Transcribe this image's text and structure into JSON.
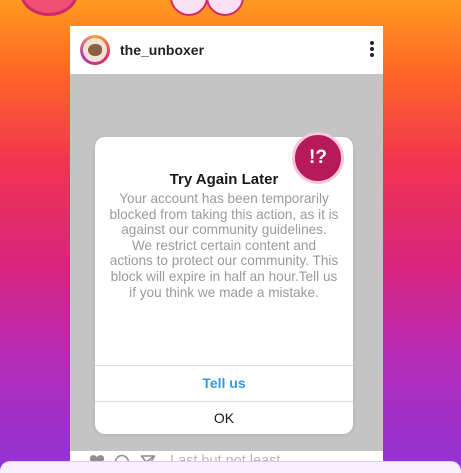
{
  "post": {
    "username": "the_unboxer",
    "caption": "Last but not least"
  },
  "alert": {
    "badge": "!?",
    "title": "Try Again Later",
    "message": "Your account has been temporarily blocked from taking this action, as it is against our community guidelines.\nWe restrict certain content and actions to protect our community. This block will expire in half an hour.Tell us if you think we made a mistake.",
    "primary_action": "Tell us",
    "secondary_action": "OK"
  },
  "icons": [
    "pink-blob-icon",
    "avatar",
    "more-options-icon",
    "heart-icon",
    "comment-icon",
    "send-icon"
  ],
  "colors": {
    "accent_blue": "#2f9be6",
    "badge_magenta": "#b61a59",
    "placeholder_gray": "#c4c4c4"
  }
}
